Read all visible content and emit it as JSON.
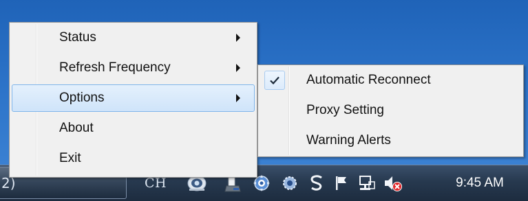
{
  "menu": {
    "items": [
      {
        "label": "Status",
        "has_submenu": true
      },
      {
        "label": "Refresh Frequency",
        "has_submenu": true
      },
      {
        "label": "Options",
        "has_submenu": true,
        "highlighted": true
      },
      {
        "label": "About",
        "has_submenu": false
      },
      {
        "label": "Exit",
        "has_submenu": false
      }
    ]
  },
  "submenu": {
    "items": [
      {
        "label": "Automatic Reconnect",
        "checked": true
      },
      {
        "label": "Proxy Setting",
        "checked": false
      },
      {
        "label": "Warning Alerts",
        "checked": false
      }
    ]
  },
  "taskbar": {
    "task_button_label": "2)",
    "language": "CH",
    "clock": "9:45 AM",
    "tray_icons": [
      "language-bar-icon",
      "printer-icon",
      "sync-icon",
      "gear-shield-icon",
      "s-app-icon",
      "action-center-flag-icon",
      "network-icon",
      "volume-muted-icon"
    ]
  },
  "colors": {
    "highlight_fill": "#cfe4fa",
    "highlight_border": "#7eb4ea",
    "menu_bg": "#f0f0f0",
    "taskbar": "#27394f",
    "desktop": "#2d74c9",
    "muted_x": "#e0262a"
  }
}
